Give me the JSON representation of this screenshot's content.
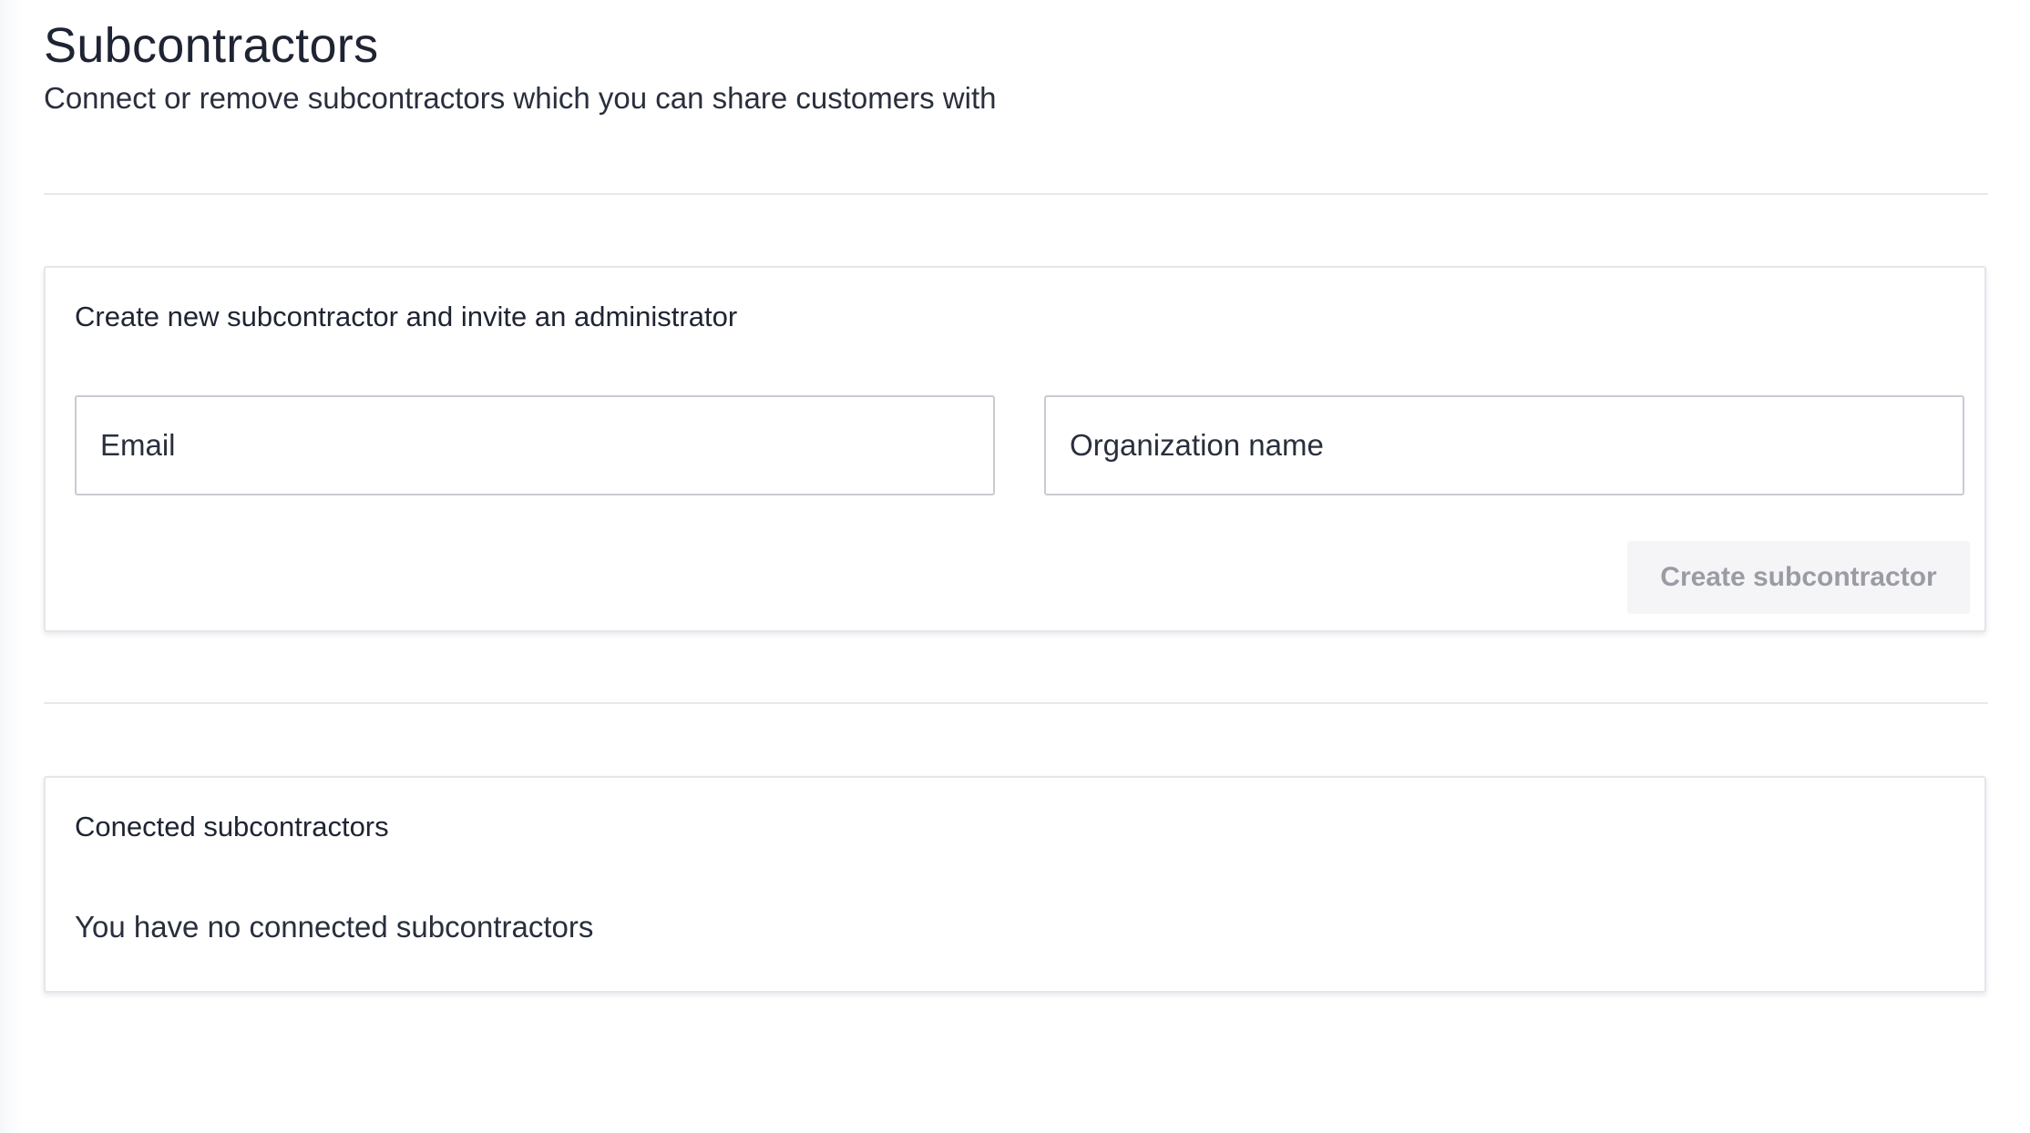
{
  "header": {
    "title": "Subcontractors",
    "subtitle": "Connect or remove subcontractors which you can share customers with"
  },
  "create_section": {
    "title": "Create new subcontractor and invite an administrator",
    "email_field": {
      "placeholder": "Email",
      "value": ""
    },
    "organization_field": {
      "placeholder": "Organization name",
      "value": ""
    },
    "submit_label": "Create subcontractor",
    "submit_enabled": false
  },
  "connected_section": {
    "title": "Conected subcontractors",
    "empty_message": "You have no connected subcontractors",
    "items": []
  },
  "colors": {
    "text_primary": "#1f2433",
    "border": "#e4e6eb",
    "input_border": "#c9cbd2",
    "disabled_button_bg": "#f5f5f7",
    "disabled_button_text": "#9a9ca4"
  }
}
